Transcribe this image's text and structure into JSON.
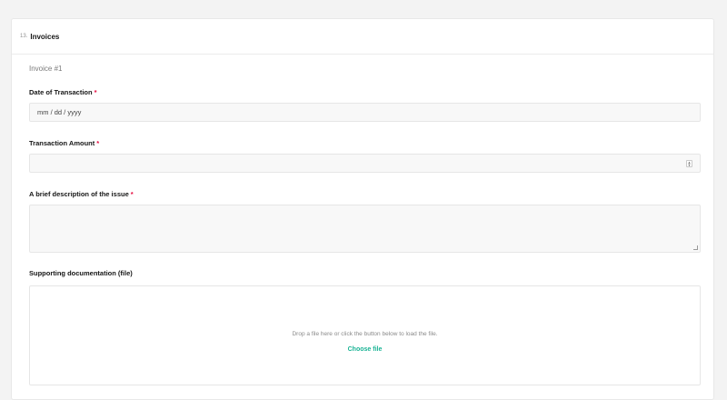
{
  "panel": {
    "number": "13.",
    "title": "Invoices"
  },
  "invoice": {
    "label": "Invoice #1"
  },
  "questions": {
    "date": {
      "title": "Date of Transaction",
      "required": "*",
      "placeholder": "mm / dd / yyyy"
    },
    "amount": {
      "title": "Transaction Amount",
      "required": "*",
      "value": ""
    },
    "description": {
      "title": "A brief description of the issue",
      "required": "*",
      "value": ""
    },
    "documentation": {
      "title": "Supporting documentation (file)",
      "drop_text": "Drop a file here or click the button below to load the file.",
      "button_label": "Choose file"
    }
  },
  "colors": {
    "accent": "#19b394",
    "required": "#e50a3e",
    "background": "#f3f3f3"
  }
}
